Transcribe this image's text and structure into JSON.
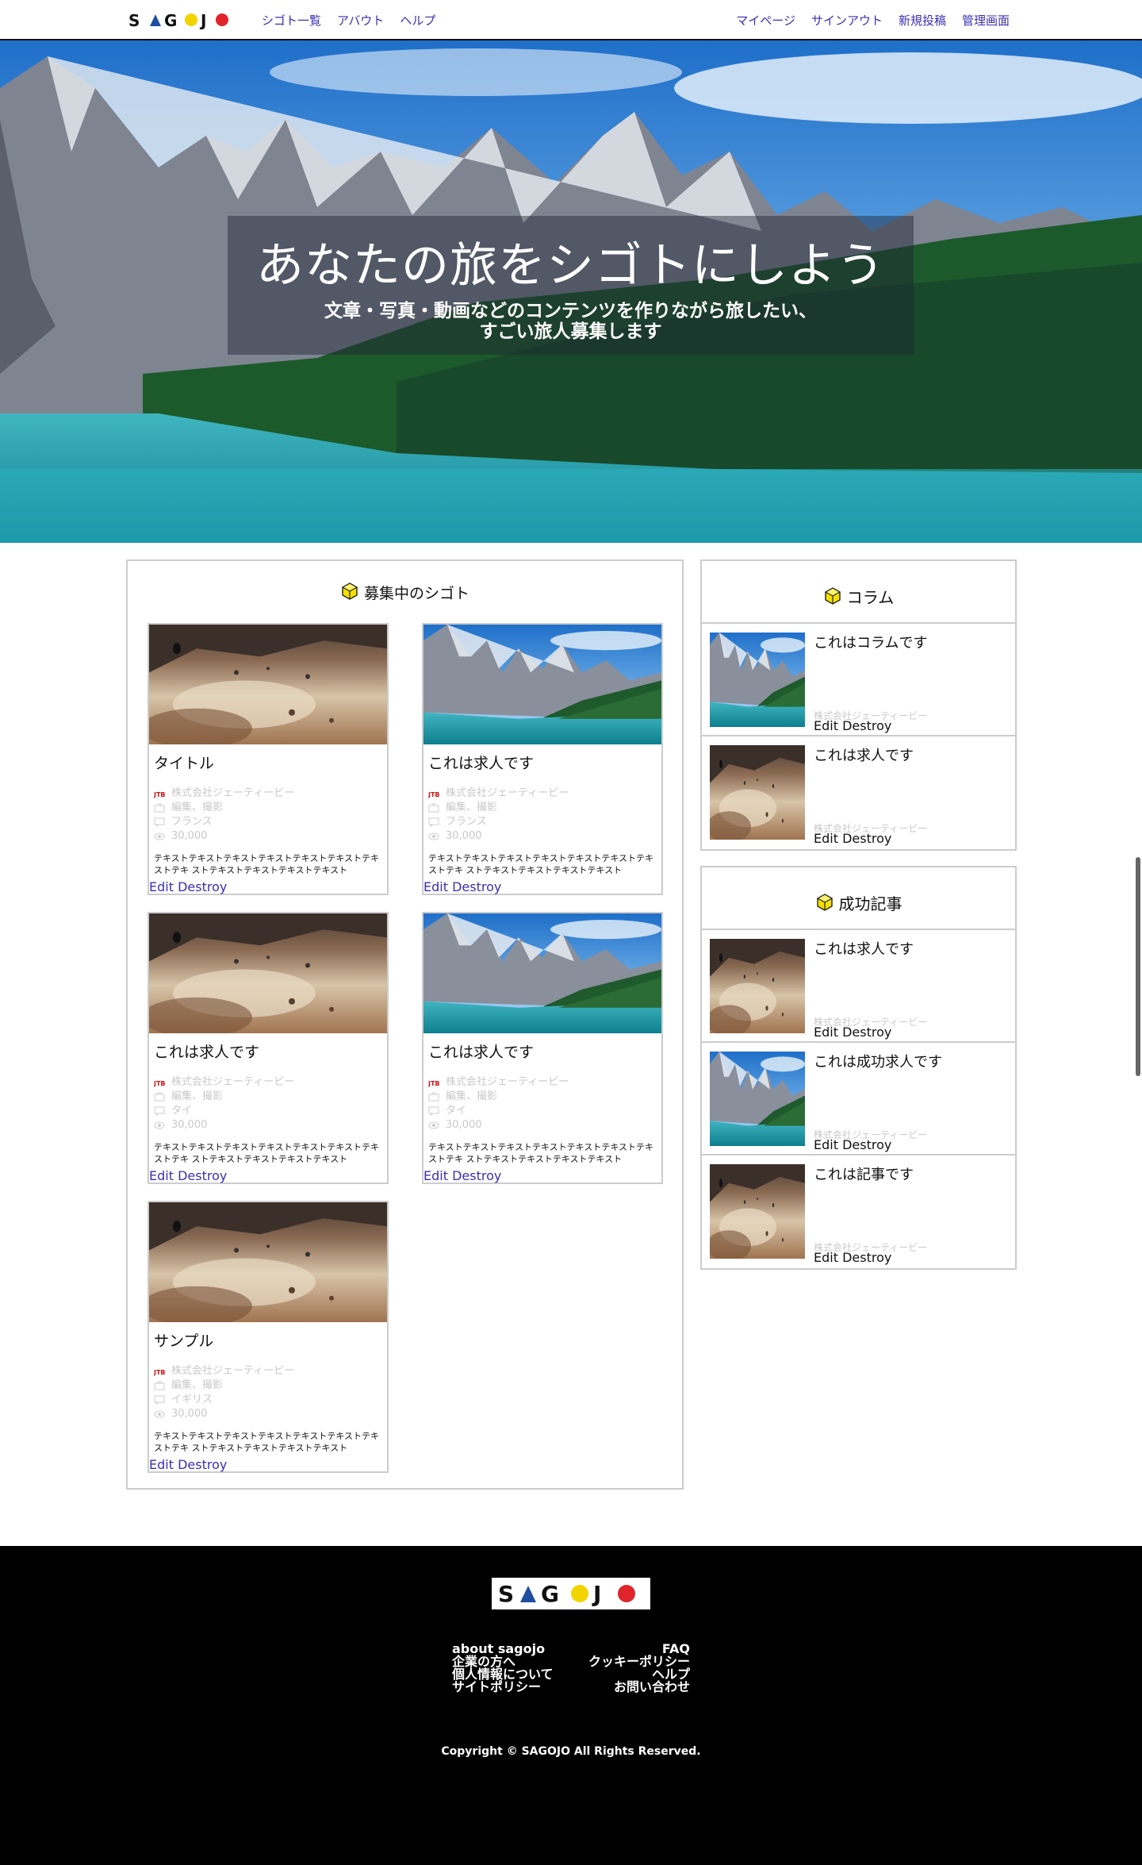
{
  "header": {
    "logo": "SAGOJO",
    "nav_left": [
      "シゴト一覧",
      "アバウト",
      "ヘルプ"
    ],
    "nav_right": [
      "マイページ",
      "サインアウト",
      "新規投稿",
      "管理画面"
    ]
  },
  "hero": {
    "title": "あなたの旅をシゴトにしよう",
    "subtitle_line1": "文章・写真・動画などのコンテンツを作りながら旅したい、",
    "subtitle_line2": "すごい旅人募集します"
  },
  "jobs": {
    "heading": "募集中のシゴト",
    "cards": [
      {
        "title": "タイトル",
        "company": "株式会社ジェーティービー",
        "category": "編集、撮影",
        "country": "フランス",
        "reward": "30,000",
        "desc": "テキストテキストテキストテキストテキストテキストテキ ストテキ ストテキストテキストテキストテキスト",
        "image": "balloon-icon",
        "edit": "Edit",
        "destroy": "Destroy"
      },
      {
        "title": "これは求人です",
        "company": "株式会社ジェーティービー",
        "category": "編集、撮影",
        "country": "フランス",
        "reward": "30,000",
        "desc": "テキストテキストテキストテキストテキストテキストテキ ストテキ ストテキストテキストテキストテキスト",
        "image": "mountain-icon",
        "edit": "Edit",
        "destroy": "Destroy"
      },
      {
        "title": "これは求人です",
        "company": "株式会社ジェーティービー",
        "category": "編集、撮影",
        "country": "タイ",
        "reward": "30,000",
        "desc": "テキストテキストテキストテキストテキストテキストテキ ストテキ ストテキストテキストテキストテキスト",
        "image": "balloon-icon",
        "edit": "Edit",
        "destroy": "Destroy"
      },
      {
        "title": "これは求人です",
        "company": "株式会社ジェーティービー",
        "category": "編集、撮影",
        "country": "タイ",
        "reward": "30,000",
        "desc": "テキストテキストテキストテキストテキストテキストテキ ストテキ ストテキストテキストテキストテキスト",
        "image": "mountain-icon",
        "edit": "Edit",
        "destroy": "Destroy"
      },
      {
        "title": "サンプル",
        "company": "株式会社ジェーティービー",
        "category": "編集、撮影",
        "country": "イギリス",
        "reward": "30,000",
        "desc": "テキストテキストテキストテキストテキストテキストテキ ストテキ ストテキストテキストテキストテキスト",
        "image": "balloon-icon",
        "edit": "Edit",
        "destroy": "Destroy"
      }
    ]
  },
  "column": {
    "heading": "コラム",
    "items": [
      {
        "title": "これはコラムです",
        "company": "株式会社ジェーティービー",
        "image": "mountain-icon",
        "edit": "Edit",
        "destroy": "Destroy"
      },
      {
        "title": "これは求人です",
        "company": "株式会社ジェーティービー",
        "image": "balloon-icon",
        "edit": "Edit",
        "destroy": "Destroy"
      }
    ]
  },
  "success": {
    "heading": "成功記事",
    "items": [
      {
        "title": "これは求人です",
        "company": "株式会社ジェーティービー",
        "image": "balloon-icon",
        "edit": "Edit",
        "destroy": "Destroy"
      },
      {
        "title": "これは成功求人です",
        "company": "株式会社ジェーティービー",
        "image": "mountain-icon",
        "edit": "Edit",
        "destroy": "Destroy"
      },
      {
        "title": "これは記事です",
        "company": "株式会社ジェーティービー",
        "image": "balloon-icon",
        "edit": "Edit",
        "destroy": "Destroy"
      }
    ]
  },
  "footer": {
    "logo": "SAGOJO",
    "links_left": [
      "about sagojo",
      "企業の方へ",
      "個人情報について",
      "サイトポリシー"
    ],
    "links_right": [
      "FAQ",
      "クッキーポリシー",
      "ヘルプ",
      "お問い合わせ"
    ],
    "copyright": "Copyright © SAGOJO All Rights Reserved."
  },
  "colors": {
    "accent": "#3a2fb0",
    "logo_yellow": "#f2d400",
    "logo_red": "#e0242b",
    "footer_bg": "#000000"
  }
}
